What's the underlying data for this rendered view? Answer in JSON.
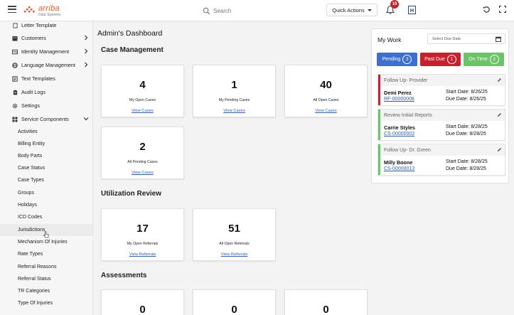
{
  "header": {
    "logo_name": "arriba",
    "logo_sub": "Data Systems",
    "search_placeholder": "Search",
    "quick_actions_label": "Quick Actions",
    "notification_count": "10",
    "profile_initial": "H"
  },
  "sidebar": {
    "items": [
      {
        "label": "Letter Template",
        "icon": "document-icon",
        "chevron": false
      },
      {
        "label": "Customers",
        "icon": "building-icon",
        "chevron": true
      },
      {
        "label": "Identity Management",
        "icon": "id-card-icon",
        "chevron": true
      },
      {
        "label": "Language Management",
        "icon": "globe-icon",
        "chevron": true
      },
      {
        "label": "Text Templates",
        "icon": "text-template-icon",
        "chevron": false
      },
      {
        "label": "Audit Logs",
        "icon": "clipboard-icon",
        "chevron": false
      },
      {
        "label": "Settings",
        "icon": "gear-icon",
        "chevron": false
      },
      {
        "label": "Service Components",
        "icon": "components-icon",
        "chevron": "down"
      }
    ],
    "subitems": [
      "Activities",
      "Billing Entity",
      "Body Parts",
      "Case Status",
      "Case Types",
      "Groups",
      "Holidays",
      "ICD Codes",
      "Jurisdictions",
      "Mechanism Of Injuries",
      "Rate Types",
      "Referral Reasons",
      "Referral Status",
      "TR Categories",
      "Type Of Injuries"
    ]
  },
  "main": {
    "page_title": "Admin's Dashboard",
    "case_management": {
      "title": "Case Management",
      "cards": [
        {
          "value": "4",
          "label": "My Open Cases",
          "link": "View Cases"
        },
        {
          "value": "1",
          "label": "My Pending Cases",
          "link": "View Cases"
        },
        {
          "value": "40",
          "label": "All Open Cases",
          "link": "View Cases"
        },
        {
          "value": "2",
          "label": "All Pending Cases",
          "link": "View Cases"
        }
      ]
    },
    "utilization_review": {
      "title": "Utilization Review",
      "cards": [
        {
          "value": "17",
          "label": "My Open Referrals",
          "link": "View Referrals"
        },
        {
          "value": "51",
          "label": "All Open Referrals",
          "link": "View Referrals"
        }
      ]
    },
    "assessments": {
      "title": "Assessments",
      "cards": [
        {
          "value": "0"
        },
        {
          "value": "0"
        },
        {
          "value": "0"
        }
      ]
    }
  },
  "my_work": {
    "title": "My Work",
    "due_date_placeholder": "Select Due Date",
    "pills": [
      {
        "label": "Pending",
        "count": "3",
        "color": "#3d6fd1"
      },
      {
        "label": "Past Due",
        "count": "1",
        "color": "#c8202f"
      },
      {
        "label": "On Time",
        "count": "2",
        "color": "#6cc36a"
      }
    ],
    "items": [
      {
        "header": "Follow Up- Provider",
        "name": "Demi Perez",
        "ref": "RF-00000008",
        "start": "Start Date: 8/26/25",
        "due": "Due Date: 8/26/25",
        "color": "#c8202f"
      },
      {
        "header": "Review Initial Reports",
        "name": "Carrie Styles",
        "ref": "CS-00000002",
        "start": "Start Date: 8/28/25",
        "due": "Due Date: 8/28/25",
        "color": "#6cc36a"
      },
      {
        "header": "Follow Up- Dr. Green",
        "name": "Milly Boone",
        "ref": "CS-00000013",
        "start": "Start Date: 8/28/25",
        "due": "Due Date: 8/28/25",
        "color": "#6cc36a"
      }
    ]
  }
}
